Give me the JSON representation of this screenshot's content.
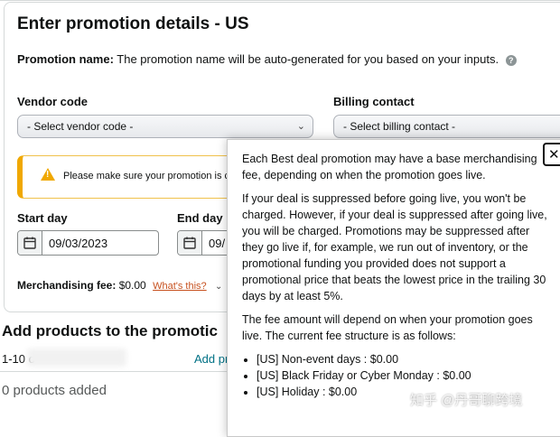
{
  "page": {
    "title": "Enter promotion details - US",
    "promotion_name_label": "Promotion name:",
    "promotion_name_text": "The promotion name will be auto-generated for you based on your inputs."
  },
  "vendor": {
    "label": "Vendor code",
    "placeholder": "- Select vendor code -"
  },
  "billing": {
    "label": "Billing contact",
    "placeholder": "- Select billing contact -"
  },
  "alert": {
    "text": "Please make sure your promotion is c"
  },
  "start_day": {
    "label": "Start day",
    "value": "09/03/2023"
  },
  "end_day": {
    "label": "End day",
    "value": "09/"
  },
  "fee": {
    "label": "Merchandising fee:",
    "value": "$0.00",
    "link": "What's this?"
  },
  "products": {
    "title": "Add products to the promotic",
    "range": "1-10 o",
    "add_link": "Add pr",
    "empty": "0 products added"
  },
  "popover": {
    "p1": "Each Best deal promotion may have a base merchandising fee, depending on when the promotion goes live.",
    "p2": "If your deal is suppressed before going live, you won't be charged. However, if your deal is suppressed after going live, you will be charged. Promotions may be suppressed after they go live if, for example, we run out of inventory, or the promotional funding you provided does not support a promotional price that beats the lowest price in the trailing 30 days by at least 5%.",
    "p3": "The fee amount will depend on when your promotion goes live. The current fee structure is as follows:",
    "items": [
      "[US] Non-event days : $0.00",
      "[US] Black Friday or Cyber Monday : $0.00",
      "[US] Holiday : $0.00"
    ]
  },
  "watermark": "知乎 @丹哥聊跨境"
}
